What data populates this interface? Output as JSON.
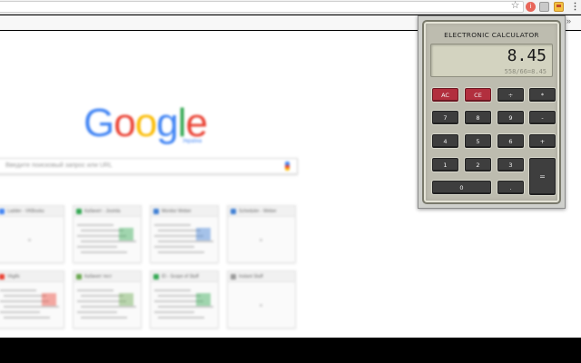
{
  "browser": {
    "icons": [
      "star-icon",
      "ext-red-icon",
      "ext-grey-icon",
      "ext-calc-icon",
      "menu-icon",
      "chevron-icon"
    ],
    "ext_red_glyph": "i",
    "menu_glyph": "⋮",
    "star_glyph": "☆",
    "chevron_glyph": "»"
  },
  "newtab": {
    "logo": [
      "G",
      "o",
      "o",
      "g",
      "l",
      "e"
    ],
    "logo_colors": [
      "#4285f4",
      "#ea4335",
      "#fbbc05",
      "#4285f4",
      "#34a853",
      "#ea4335"
    ],
    "country": "Україна",
    "search_placeholder": "Введите поисковый запрос или URL",
    "tiles": [
      {
        "title": "Ladder - VKBooks",
        "color": "#4285f4"
      },
      {
        "title": "Кабинет - Joomla",
        "color": "#34a853"
      },
      {
        "title": "Monitor Weber",
        "color": "#3f7fd4"
      },
      {
        "title": "Scheduler - Weber",
        "color": "#3f7fd4"
      },
      {
        "title": "Vkgifs",
        "color": "#ea4335"
      },
      {
        "title": "Кабинет тест",
        "color": "#6aa84f"
      },
      {
        "title": "ID - Scope of Stuff",
        "color": "#34a853"
      },
      {
        "title": "Instant Stuff",
        "color": "#999999"
      }
    ]
  },
  "calculator": {
    "title": "ELECTRONIC CALCULATOR",
    "display_value": "8.45",
    "expression": "558/66=8.45",
    "keys": {
      "ac": "AC",
      "ce": "CE",
      "divide": "÷",
      "multiply": "*",
      "seven": "7",
      "eight": "8",
      "nine": "9",
      "minus": "-",
      "four": "4",
      "five": "5",
      "six": "6",
      "plus": "+",
      "one": "1",
      "two": "2",
      "three": "3",
      "equals": "=",
      "zero": "0",
      "decimal": "."
    },
    "accent_color": "#b22f3e"
  }
}
